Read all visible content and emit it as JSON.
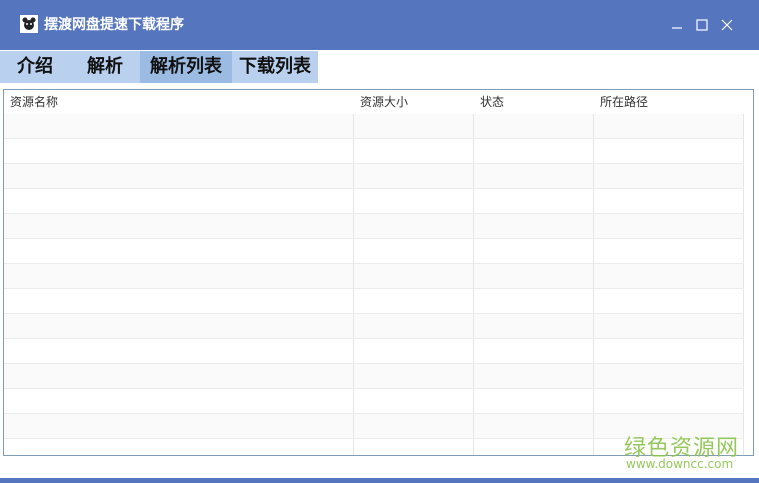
{
  "window": {
    "title": "摆渡网盘提速下载程序",
    "controls": [
      "minimize-icon",
      "maximize-icon",
      "close-icon"
    ],
    "accent_color": "#5575BE"
  },
  "tabs": [
    {
      "label": "介绍",
      "active": false
    },
    {
      "label": "解析",
      "active": false
    },
    {
      "label": "解析列表",
      "active": true
    },
    {
      "label": "下载列表",
      "active": false
    }
  ],
  "table": {
    "columns": [
      "资源名称",
      "资源大小",
      "状态",
      "所在路径"
    ],
    "rows": []
  },
  "watermark": {
    "cn": "绿色资源网",
    "url": "www.downcc.com"
  }
}
